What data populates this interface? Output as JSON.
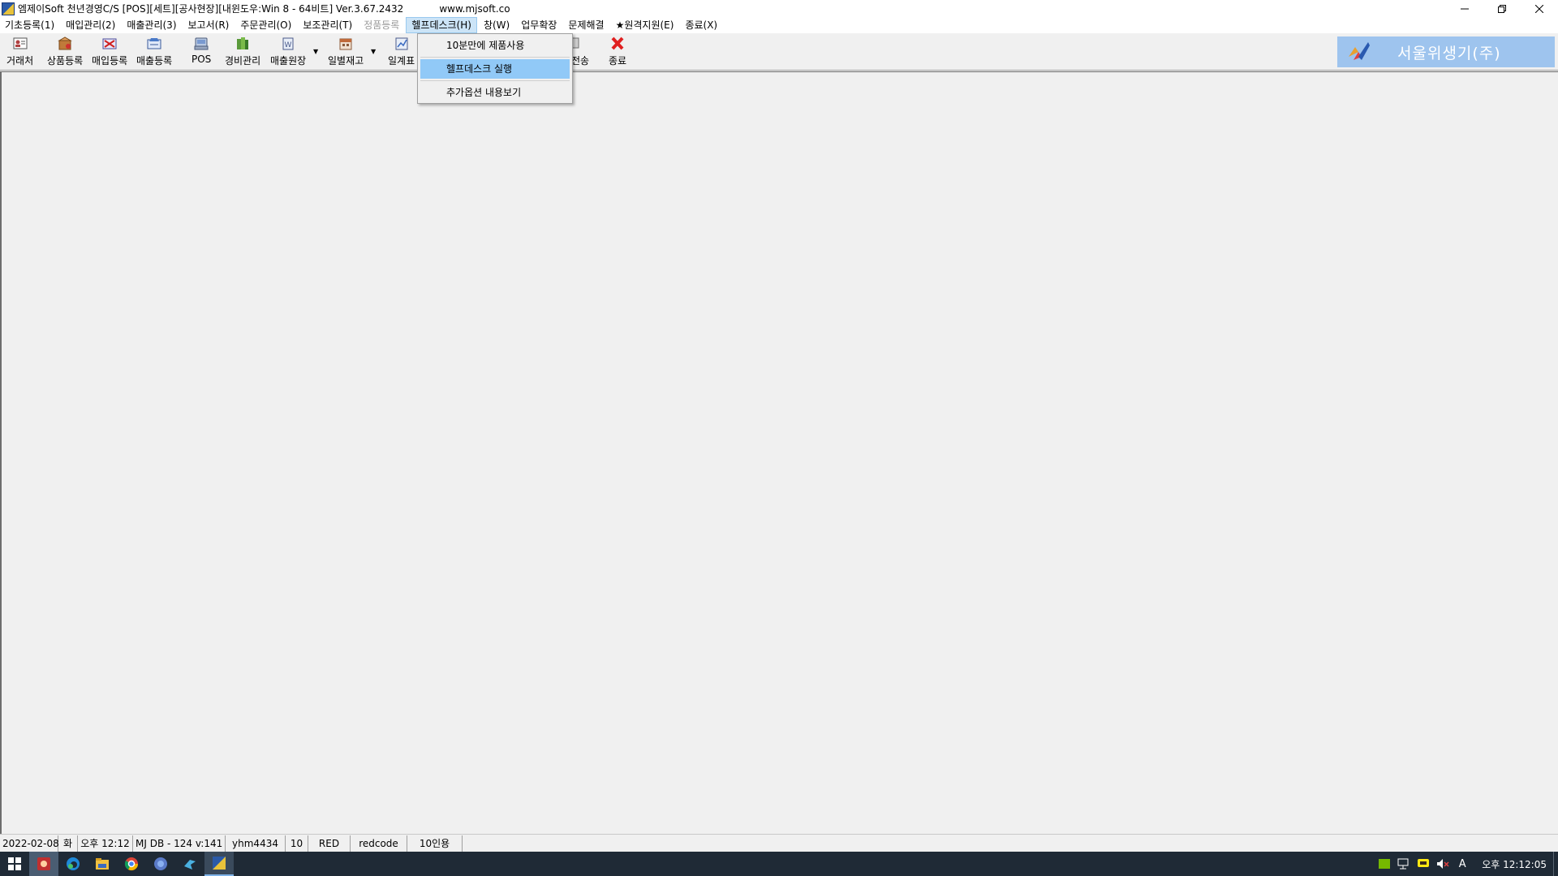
{
  "window": {
    "title": "엠제이Soft 천년경영C/S [POS][세트][공사현장][내윈도우:Win 8 - 64비트] Ver.3.67.2432",
    "url": "www.mjsoft.co"
  },
  "menu": {
    "items": [
      {
        "label": "기초등록(1)"
      },
      {
        "label": "매입관리(2)"
      },
      {
        "label": "매출관리(3)"
      },
      {
        "label": "보고서(R)"
      },
      {
        "label": "주문관리(O)"
      },
      {
        "label": "보조관리(T)"
      },
      {
        "label": "정품등록"
      },
      {
        "label": "헬프데스크(H)"
      },
      {
        "label": "창(W)"
      },
      {
        "label": "업무확장"
      },
      {
        "label": "문제해결"
      },
      {
        "label": "★원격지원(E)"
      },
      {
        "label": "종료(X)"
      }
    ]
  },
  "toolbar": {
    "buttons": [
      {
        "label": "거래처",
        "icon": "client-card-icon"
      },
      {
        "label": "상품등록",
        "icon": "product-box-icon"
      },
      {
        "label": "매입등록",
        "icon": "purchase-icon"
      },
      {
        "label": "매출등록",
        "icon": "sales-icon"
      },
      {
        "label": "POS",
        "icon": "pos-terminal-icon"
      },
      {
        "label": "경비관리",
        "icon": "expense-books-icon"
      },
      {
        "label": "매출원장",
        "icon": "ledger-icon"
      },
      {
        "label": "일별재고",
        "icon": "inventory-calendar-icon"
      },
      {
        "label": "일계표",
        "icon": "daily-chart-icon"
      },
      {
        "label": "전송",
        "icon": "transfer-icon"
      },
      {
        "label": "종료",
        "icon": "exit-x-icon"
      }
    ],
    "brand": "서울위생기(주)"
  },
  "dropdown": {
    "items": [
      {
        "label": "10분만에 제품사용"
      },
      {
        "label": "헬프데스크 실행"
      },
      {
        "label": "추가옵션 내용보기"
      }
    ]
  },
  "statusbar": {
    "date": "2022-02-08",
    "weekday": "화",
    "time": "오후 12:12",
    "db": "MJ DB - 124 v:141",
    "user": "yhm4434",
    "number": "10",
    "red": "RED",
    "code": "redcode",
    "license": "10인용"
  },
  "taskbar": {
    "clock": "오후 12:12:05",
    "ime": "A"
  },
  "colors": {
    "highlight": "#91c9f7",
    "brand_bg": "#9ec4ee",
    "taskbar_bg": "#1f2a36"
  }
}
